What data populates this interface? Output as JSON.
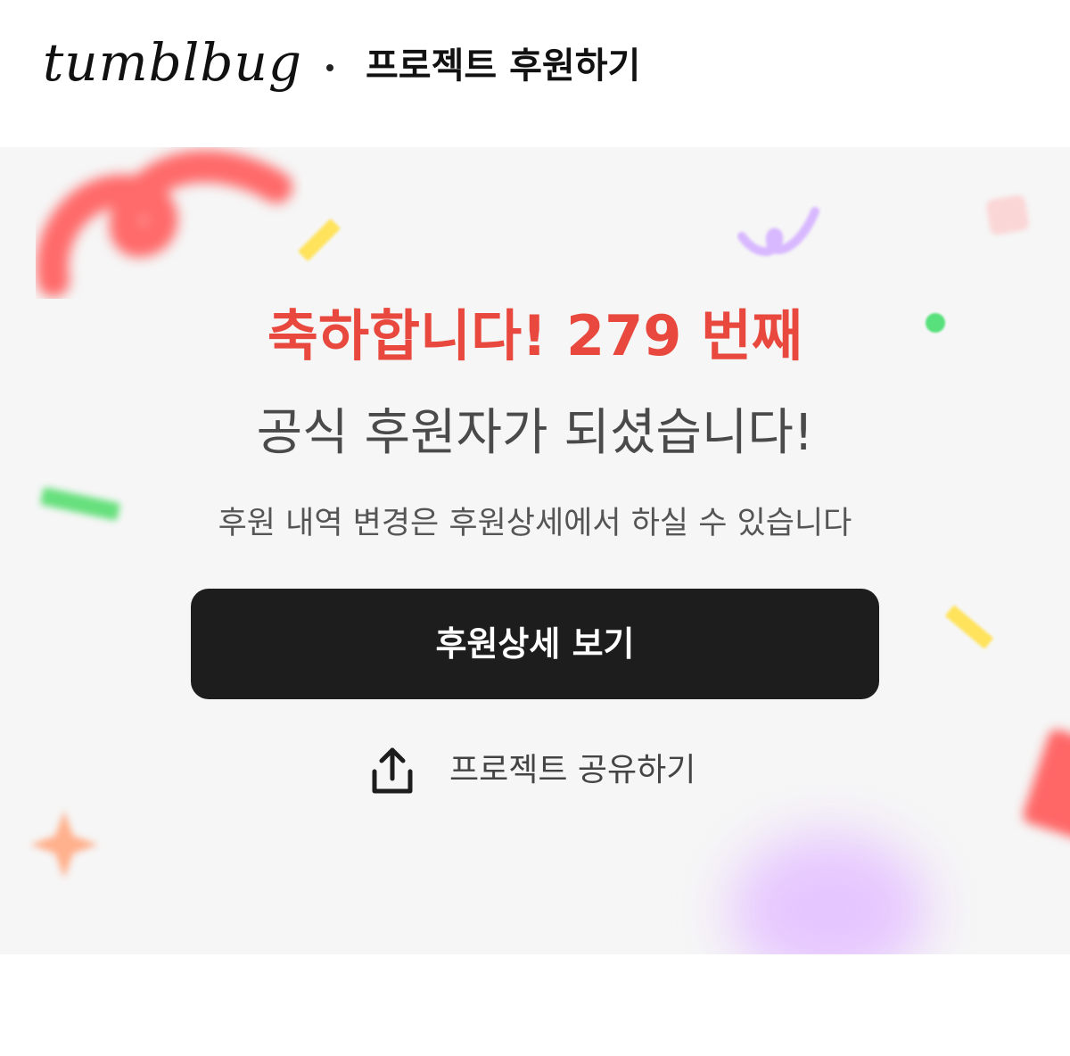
{
  "header": {
    "logo": "tumblbug",
    "title": "프로젝트 후원하기"
  },
  "main": {
    "headline": "축하합니다! 279 번째",
    "subhead": "공식 후원자가 되셨습니다!",
    "note": "후원 내역 변경은 후원상세에서 하실 수 있습니다",
    "cta_label": "후원상세 보기",
    "share_label": "프로젝트 공유하기"
  },
  "colors": {
    "accent": "#e8483d",
    "button": "#1e1d1d",
    "background": "#f6f6f6"
  },
  "icons": {
    "share": "share-upload-icon"
  }
}
